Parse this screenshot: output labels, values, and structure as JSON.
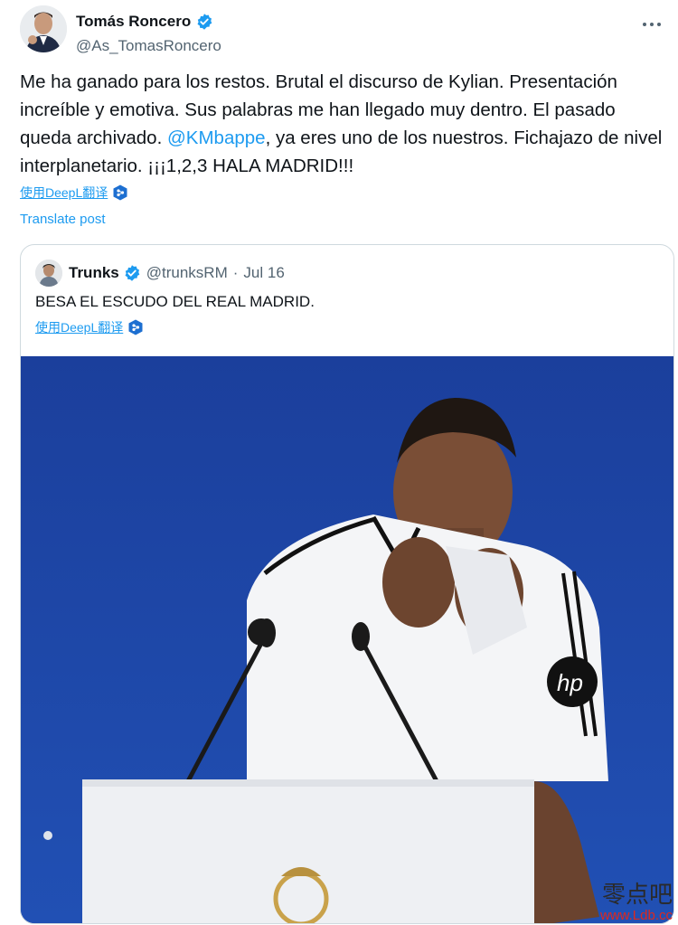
{
  "author": {
    "name": "Tomás Roncero",
    "handle": "@As_TomasRoncero",
    "more_icon": "more-horizontal-icon"
  },
  "post": {
    "text_before": "Me ha ganado para los restos. Brutal el discurso de Kylian. Presentación increíble y emotiva. Sus palabras me han llegado muy dentro. El pasado queda archivado. ",
    "mention": "@KMbappe",
    "text_after": ", ya eres uno de los nuestros. Fichajazo de nivel interplanetario. ¡¡¡1,2,3 HALA MADRID!!!",
    "deepl_label": "使用DeepL翻译",
    "translate_label": "Translate post"
  },
  "quote": {
    "name": "Trunks",
    "handle": "@trunksRM",
    "dot": "·",
    "date": "Jul 16",
    "text": "BESA EL ESCUDO DEL REAL MADRID.",
    "deepl_label": "使用DeepL翻译"
  },
  "watermark": {
    "chinese": "零点吧",
    "url": "www.Ldb.cc"
  },
  "colors": {
    "accent": "#1d9bf0",
    "text": "#0f1419",
    "secondary": "#536471",
    "photo_background": "#1e46a4"
  }
}
